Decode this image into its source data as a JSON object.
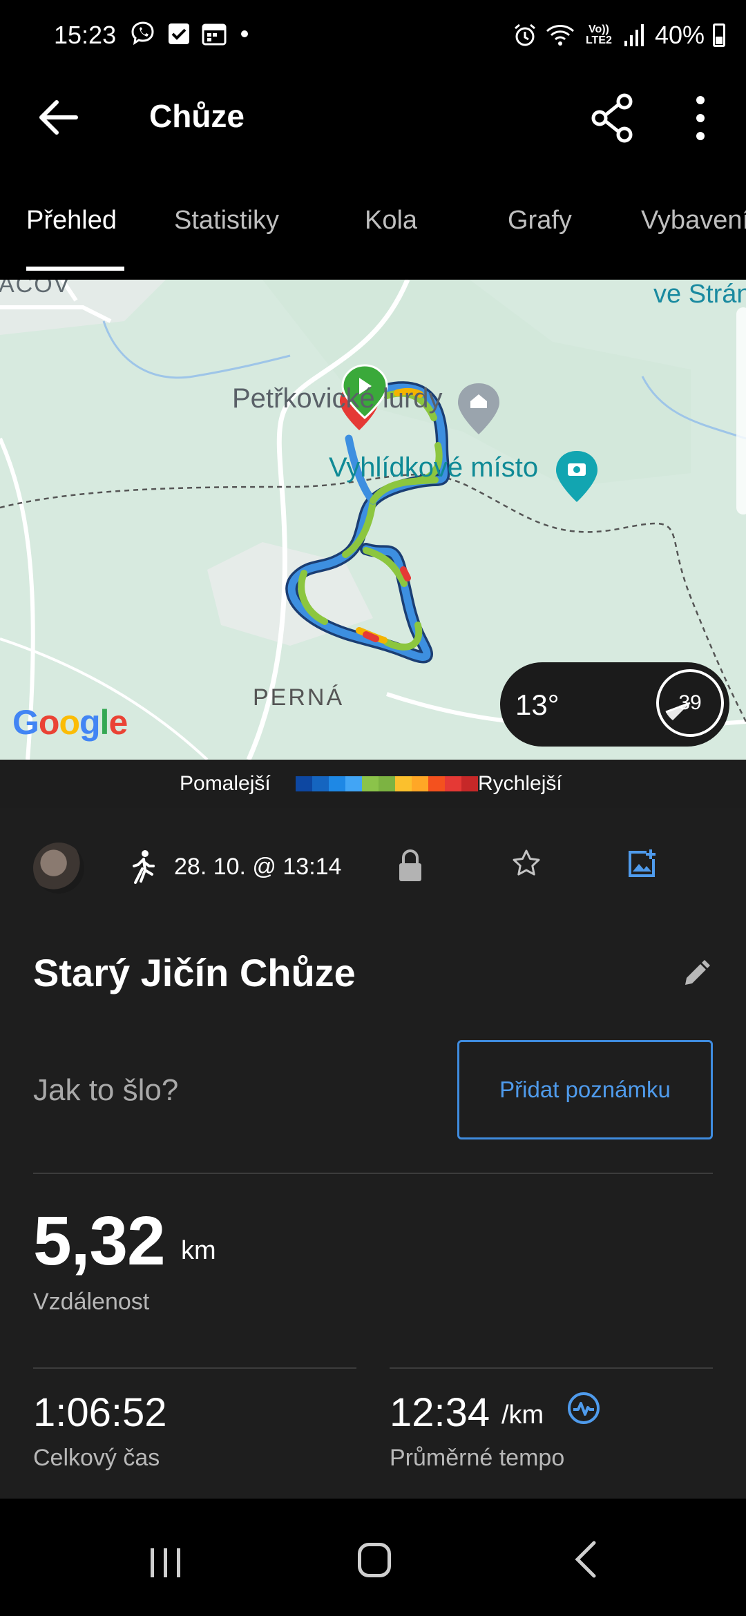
{
  "status_bar": {
    "time": "15:23",
    "lte_label": "Vo)) LTE2",
    "battery": "40%",
    "left_icons": [
      "viber-icon",
      "checkbox-icon",
      "calendar-icon",
      "dot-icon"
    ],
    "right_icons": [
      "alarm-icon",
      "wifi-icon",
      "signal-icon",
      "battery-icon"
    ]
  },
  "app_bar": {
    "title": "Chůze"
  },
  "tabs": [
    {
      "label": "Přehled",
      "active": true
    },
    {
      "label": "Statistiky",
      "active": false
    },
    {
      "label": "Kola",
      "active": false
    },
    {
      "label": "Grafy",
      "active": false
    },
    {
      "label": "Vybavení",
      "active": false
    }
  ],
  "map": {
    "labels": {
      "top_left": "ACOV",
      "top_right": "ve Strání",
      "poi_1": "Petřkovické lurdy",
      "poi_2": "Vyhlídkové místo",
      "village": "PERNÁ",
      "brand": "Google"
    },
    "weather": {
      "temperature": "13°",
      "wind_value": "39",
      "condition_icon": "cloud-icon"
    },
    "route_colors": [
      "#1565c0",
      "#2e86de",
      "#4aa3f0",
      "#7bc242",
      "#ffc107",
      "#f57c00",
      "#e53935"
    ]
  },
  "legend": {
    "slow_label": "Pomalejší",
    "fast_label": "Rychlejší",
    "colors": [
      "#0d47a1",
      "#1565c0",
      "#1e88e5",
      "#42a5f5",
      "#8bc34a",
      "#7cb342",
      "#fbc02d",
      "#ffa726",
      "#f4511e",
      "#e53935",
      "#c62828"
    ]
  },
  "activity": {
    "date": "28. 10. @ 13:14",
    "title": "Starý Jičín Chůze",
    "note_prompt": "Jak to šlo?",
    "note_button": "Přidat poznámku"
  },
  "stats": {
    "distance": {
      "value": "5,32",
      "unit": "km",
      "label": "Vzdálenost"
    },
    "total_time": {
      "value": "1:06:52",
      "label": "Celkový čas"
    },
    "avg_pace": {
      "value": "12:34",
      "unit": "/km",
      "label": "Průměrné tempo"
    }
  },
  "colors": {
    "accent": "#3f8cdf",
    "background": "#1e1e1e"
  }
}
